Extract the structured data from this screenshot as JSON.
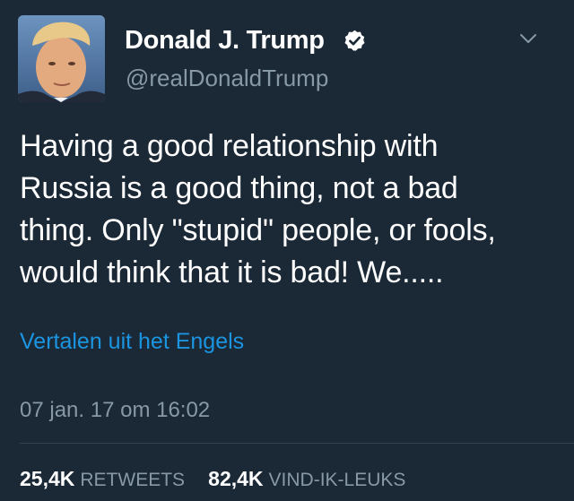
{
  "tweet": {
    "display_name": "Donald J. Trump",
    "handle": "@realDonaldTrump",
    "text": "Having a good relationship with\nRussia is a good thing, not a bad\nthing. Only \"stupid\" people, or fools,\nwould think that it is bad! We.....",
    "translate_label": "Vertalen uit het Engels",
    "timestamp": "07 jan. 17 om 16:02",
    "retweets_count": "25,4K",
    "retweets_label": "RETWEETS",
    "likes_count": "82,4K",
    "likes_label": "VIND-IK-LEUKS"
  },
  "icons": {
    "verified": "verified-badge-icon",
    "menu": "chevron-down-icon"
  },
  "colors": {
    "background": "#1b2836",
    "text": "#ffffff",
    "muted": "#8899a6",
    "link": "#1b95e0",
    "divider": "#38444d"
  }
}
